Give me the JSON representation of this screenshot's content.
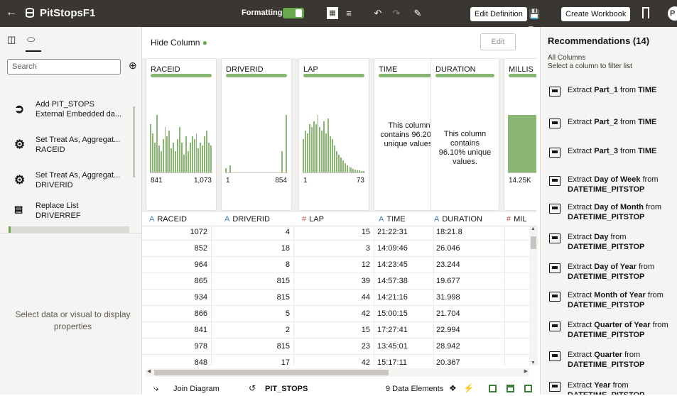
{
  "topbar": {
    "title": "PitStopsF1",
    "formatting_label": "Formatting",
    "edit_definition": "Edit Definition",
    "create_workbook": "Create Workbook",
    "avatar_initial": "P"
  },
  "left": {
    "search_placeholder": "Search",
    "steps": [
      {
        "icon": "add-data-icon",
        "line1": "Add PIT_STOPS",
        "line2": "External Embedded da..."
      },
      {
        "icon": "gear-icon",
        "line1": "Set Treat As, Aggregat...",
        "line2": "RACEID"
      },
      {
        "icon": "gear-icon",
        "line1": "Set Treat As, Aggregat...",
        "line2": "DRIVERID"
      },
      {
        "icon": "replace-list-icon",
        "line1": "Replace List",
        "line2": "DRIVERREF"
      }
    ],
    "properties_message": "Select data or visual to display properties"
  },
  "main": {
    "hide_column": "Hide Column",
    "edit_button": "Edit",
    "profiles": [
      {
        "name": "RACEID",
        "min": "841",
        "max": "1,073",
        "bars": [
          0.8,
          0.65,
          0.5,
          0.95,
          0.45,
          0.35,
          0.55,
          0.75,
          0.6,
          0.7,
          0.4,
          0.5,
          0.35,
          0.55,
          0.75,
          0.5,
          0.3,
          0.6,
          0.35,
          0.5,
          0.6,
          0.55,
          0.65,
          0.4,
          0.5,
          0.45,
          0.6,
          0.7,
          0.5,
          0.45
        ]
      },
      {
        "name": "DRIVERID",
        "min": "1",
        "max": "854",
        "bars": [
          0.07,
          0,
          0.12,
          0,
          0,
          0,
          0,
          0,
          0,
          0,
          0,
          0,
          0,
          0,
          0,
          0,
          0,
          0,
          0,
          0,
          0,
          0,
          0,
          0,
          0,
          0,
          0,
          0.35,
          0,
          0.95
        ]
      },
      {
        "name": "LAP",
        "min": "1",
        "max": "73",
        "bars": [
          0.55,
          0.7,
          0.65,
          0.8,
          0.75,
          0.85,
          0.8,
          0.95,
          0.75,
          0.7,
          0.85,
          0.65,
          0.9,
          0.6,
          0.55,
          0.45,
          0.35,
          0.3,
          0.25,
          0.2,
          0.15,
          0.12,
          0.1,
          0.08,
          0.06,
          0.05,
          0.04,
          0.03,
          0.02,
          0.02
        ]
      },
      {
        "name": "TIME",
        "unique": "This column contains 96.20% unique values."
      },
      {
        "name": "DURATION",
        "unique": "This column contains 96.10% unique values."
      },
      {
        "name": "MILLIS",
        "min": "14.25K",
        "max": "",
        "bars": [
          0.95
        ]
      }
    ],
    "headers": [
      {
        "type": "A",
        "name": "RACEID"
      },
      {
        "type": "A",
        "name": "DRIVERID"
      },
      {
        "type": "#",
        "name": "LAP"
      },
      {
        "type": "A",
        "name": "TIME"
      },
      {
        "type": "A",
        "name": "DURATION"
      },
      {
        "type": "#",
        "name": "MIL"
      }
    ],
    "rows": [
      [
        "1072",
        "4",
        "15",
        "21:22:31",
        "18:21.8"
      ],
      [
        "852",
        "18",
        "3",
        "14:09:46",
        "26.046"
      ],
      [
        "964",
        "8",
        "12",
        "14:23:45",
        "23.244"
      ],
      [
        "865",
        "815",
        "39",
        "14:57:38",
        "19.677"
      ],
      [
        "934",
        "815",
        "44",
        "14:21:16",
        "31.998"
      ],
      [
        "866",
        "5",
        "42",
        "15:00:15",
        "21.704"
      ],
      [
        "841",
        "2",
        "15",
        "17:27:41",
        "22.994"
      ],
      [
        "978",
        "815",
        "23",
        "13:45:01",
        "28.942"
      ],
      [
        "848",
        "17",
        "42",
        "15:17:11",
        "20.367"
      ]
    ],
    "bottom": {
      "join_diagram": "Join Diagram",
      "dataset_name": "PIT_STOPS",
      "data_elements": "9 Data Elements"
    }
  },
  "right": {
    "title": "Recommendations (14)",
    "sub1": "All Columns",
    "sub2": "Select a column to filter list",
    "recs": [
      {
        "pre": "Extract ",
        "bold": "Part_1",
        "mid": " from ",
        "bold2": "TIME"
      },
      {
        "pre": "Extract ",
        "bold": "Part_2",
        "mid": " from ",
        "bold2": "TIME"
      },
      {
        "pre": "Extract ",
        "bold": "Part_3",
        "mid": " from ",
        "bold2": "TIME"
      },
      {
        "pre": "Extract ",
        "bold": "Day of Week",
        "mid": " from ",
        "bold2": "DATETIME_PITSTOP"
      },
      {
        "pre": "Extract ",
        "bold": "Day of Month",
        "mid": " from ",
        "bold2": "DATETIME_PITSTOP"
      },
      {
        "pre": "Extract ",
        "bold": "Day",
        "mid": " from ",
        "bold2": "DATETIME_PITSTOP"
      },
      {
        "pre": "Extract ",
        "bold": "Day of Year",
        "mid": " from ",
        "bold2": "DATETIME_PITSTOP"
      },
      {
        "pre": "Extract ",
        "bold": "Month of Year",
        "mid": " from ",
        "bold2": "DATETIME_PITSTOP"
      },
      {
        "pre": "Extract ",
        "bold": "Quarter of Year",
        "mid": " from ",
        "bold2": "DATETIME_PITSTOP"
      },
      {
        "pre": "Extract ",
        "bold": "Quarter",
        "mid": " from ",
        "bold2": "DATETIME_PITSTOP"
      },
      {
        "pre": "Extract ",
        "bold": "Year",
        "mid": " from ",
        "bold2": "DATETIME_PITSTOP"
      }
    ]
  }
}
